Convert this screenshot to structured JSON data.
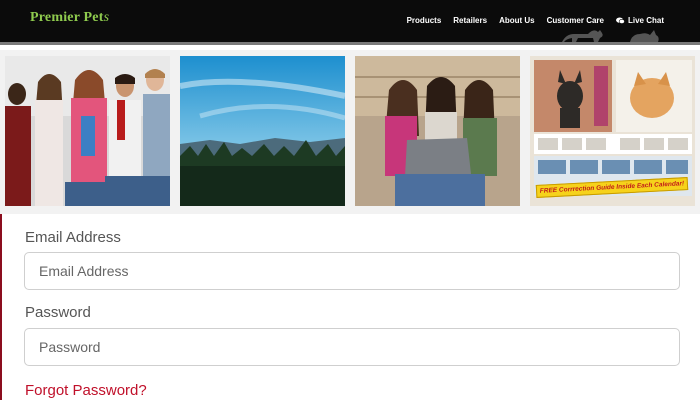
{
  "header": {
    "logo_main": "Premier Pet",
    "logo_tail": "s",
    "nav": [
      "Products",
      "Retailers",
      "About Us",
      "Customer Care"
    ],
    "chat_label": "Live Chat"
  },
  "gallery": {
    "calendar_banner": "FREE Corrrection Guide Inside Each Calendar!"
  },
  "form": {
    "email_label": "Email Address",
    "email_placeholder": "Email Address",
    "password_label": "Password",
    "password_placeholder": "Password",
    "forgot_label": "Forgot Password?"
  },
  "colors": {
    "header_bg": "#0b0b0b",
    "logo": "#8fcb4e",
    "link_red": "#c0102a",
    "accent_rule": "#8b0d1e"
  }
}
